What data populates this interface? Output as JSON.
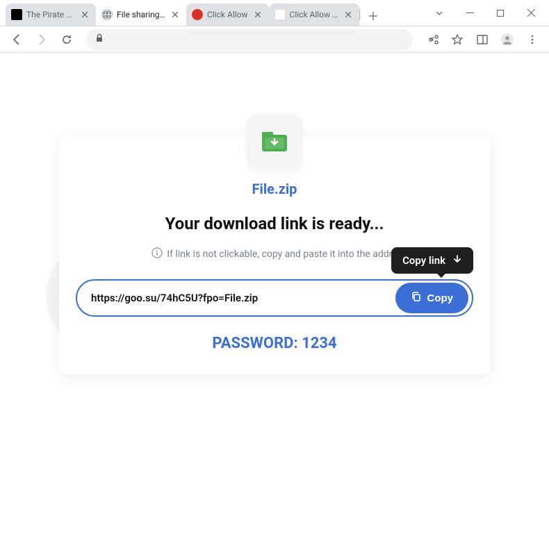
{
  "tabs": [
    {
      "title": "The Pirate Bay",
      "active": false
    },
    {
      "title": "File sharing se",
      "active": true
    },
    {
      "title": "Click Allow",
      "active": false
    },
    {
      "title": "Click Allow if y",
      "active": false
    }
  ],
  "page": {
    "filename": "File.zip",
    "headline": "Your download link is ready...",
    "hint": "If link is not clickable, copy and paste it into the addre",
    "link_url": "https://goo.su/74hC5U?fpo=File.zip",
    "copy_label": "Copy",
    "tooltip": "Copy link",
    "password_label": "PASSWORD: 1234"
  },
  "colors": {
    "accent": "#3b6fd6"
  }
}
